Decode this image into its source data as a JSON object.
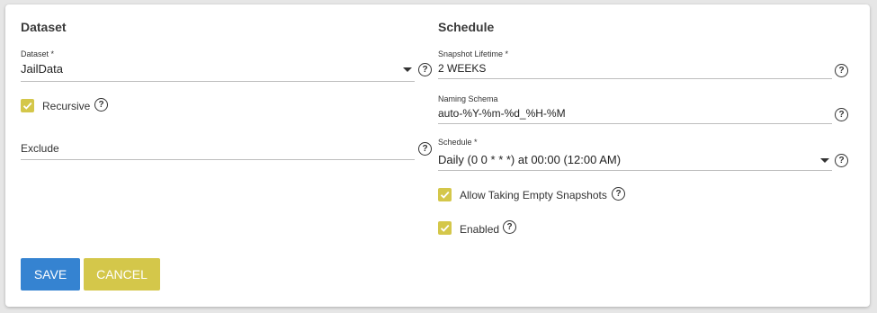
{
  "left": {
    "section_title": "Dataset",
    "dataset": {
      "label": "Dataset *",
      "value": "JailData"
    },
    "recursive": {
      "label": "Recursive",
      "checked": true
    },
    "exclude": {
      "label": "Exclude",
      "value": ""
    }
  },
  "right": {
    "section_title": "Schedule",
    "snapshot_lifetime": {
      "label": "Snapshot Lifetime *",
      "value": "2 WEEKS"
    },
    "naming_schema": {
      "label": "Naming Schema",
      "value": "auto-%Y-%m-%d_%H-%M"
    },
    "schedule": {
      "label": "Schedule *",
      "value": "Daily (0 0 * * *) at 00:00 (12:00 AM)"
    },
    "allow_empty": {
      "label": "Allow Taking Empty Snapshots",
      "checked": true
    },
    "enabled": {
      "label": "Enabled",
      "checked": true
    }
  },
  "buttons": {
    "save": "SAVE",
    "cancel": "CANCEL"
  },
  "help_glyph": "?",
  "colors": {
    "save": "#3583d1",
    "accent": "#d4c74a"
  }
}
